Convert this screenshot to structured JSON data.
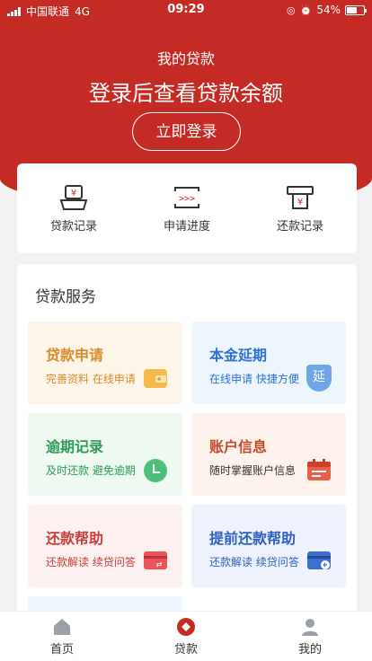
{
  "status": {
    "carrier": "中国联通",
    "network": "4G",
    "time": "09:29",
    "battery": "54%"
  },
  "hero": {
    "title": "我的贷款",
    "amount_text": "登录后查看贷款余额",
    "login_label": "立即登录"
  },
  "quick": [
    {
      "label": "贷款记录",
      "icon": "loan-record-icon"
    },
    {
      "label": "申请进度",
      "icon": "progress-icon"
    },
    {
      "label": "还款记录",
      "icon": "repay-record-icon"
    }
  ],
  "services": {
    "title": "贷款服务",
    "cards": [
      {
        "title": "贷款申请",
        "sub": "完善资料 在线申请",
        "icon": "wallet-icon",
        "bg": "#fdf6e8",
        "color": "#d98b2b"
      },
      {
        "title": "本金延期",
        "sub": "在线申请 快捷方便",
        "icon": "extend-shield-icon",
        "bg": "#edf5fd",
        "color": "#2f6fcf"
      },
      {
        "title": "逾期记录",
        "sub": "及时还款 避免逾期",
        "icon": "clock-icon",
        "bg": "#edf9f1",
        "color": "#2e9a55"
      },
      {
        "title": "账户信息",
        "sub": "随时掌握账户信息",
        "icon": "calendar-icon",
        "bg": "#fdf2ec",
        "color": "#c44a2b"
      },
      {
        "title": "还款帮助",
        "sub": "还款解读 续贷问答",
        "icon": "card-transfer-icon",
        "bg": "#fdf0f0",
        "color": "#c4403a"
      },
      {
        "title": "提前还款帮助",
        "sub": "还款解读 续贷问答",
        "icon": "card-return-icon",
        "bg": "#edf2fd",
        "color": "#2f5fbf"
      }
    ],
    "extend_char": "延"
  },
  "tabs": [
    {
      "label": "首页",
      "icon": "home-icon"
    },
    {
      "label": "贷款",
      "icon": "loan-icon"
    },
    {
      "label": "我的",
      "icon": "profile-icon"
    }
  ],
  "colors": {
    "brand": "#c42b24"
  }
}
